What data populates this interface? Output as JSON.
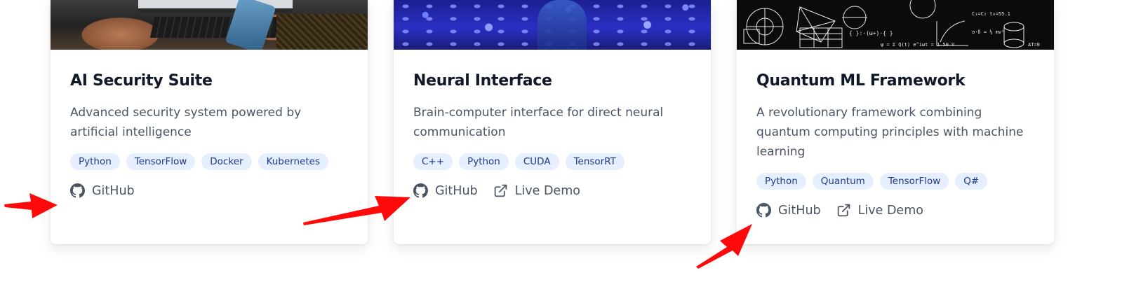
{
  "projects": [
    {
      "title": "AI Security Suite",
      "description": "Advanced security system powered by artificial intelligence",
      "tags": [
        "Python",
        "TensorFlow",
        "Docker",
        "Kubernetes"
      ],
      "links": {
        "github": "GitHub"
      },
      "image_icon": "laptop-photo"
    },
    {
      "title": "Neural Interface",
      "description": "Brain-computer interface for direct neural communication",
      "tags": [
        "C++",
        "Python",
        "CUDA",
        "TensorRT"
      ],
      "links": {
        "github": "GitHub",
        "demo": "Live Demo"
      },
      "image_icon": "neural-network-photo"
    },
    {
      "title": "Quantum ML Framework",
      "description": "A revolutionary framework combining quantum computing principles with machine learning",
      "tags": [
        "Python",
        "Quantum",
        "TensorFlow",
        "Q#"
      ],
      "links": {
        "github": "GitHub",
        "demo": "Live Demo"
      },
      "image_icon": "math-chalkboard-photo"
    }
  ],
  "icons": {
    "github": "github-icon",
    "external": "external-link-icon"
  },
  "colors": {
    "tag_bg": "#e6efff",
    "tag_text": "#1e3a8a",
    "title": "#111827",
    "body_text": "#4b5563",
    "annotation_arrow": "#ff0a0a"
  }
}
